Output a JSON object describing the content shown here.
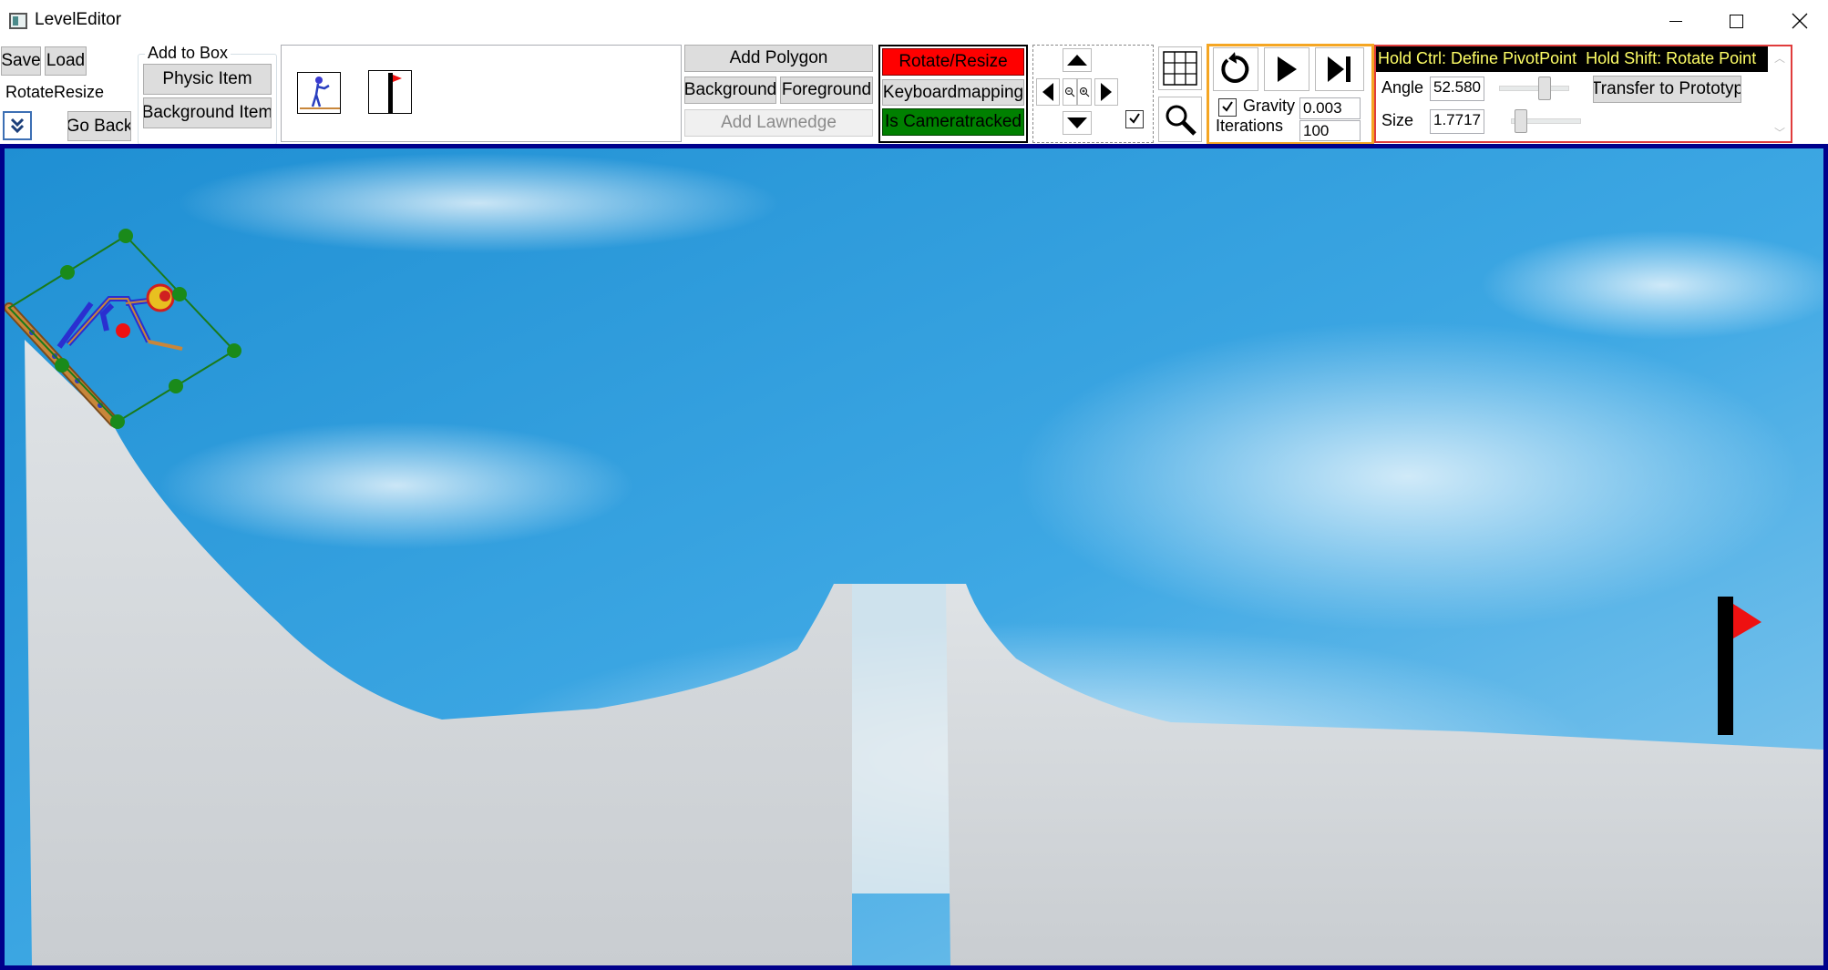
{
  "window": {
    "title": "LevelEditor"
  },
  "toolbar": {
    "save": "Save",
    "load": "Load",
    "mode": "RotateResize",
    "go_back": "Go Back",
    "add_to_box": {
      "title": "Add to Box",
      "physic_item": "Physic Item",
      "background_item": "Background Item"
    },
    "prototypes": [
      "skier-prototype",
      "flag-prototype"
    ],
    "add_polygon": "Add Polygon",
    "background": "Background",
    "foreground": "Foreground",
    "add_lawnedge": "Add Lawnedge",
    "rotate_resize": "Rotate/Resize",
    "keyboardmapping": "Keyboardmapping",
    "is_cameratracked": "Is Cameratracked",
    "simulation": {
      "gravity_label": "Gravity",
      "gravity_checked": true,
      "gravity_value": "0.003",
      "iterations_label": "Iterations",
      "iterations_value": "100"
    },
    "hint": "Hold Ctrl: Define PivotPoint  Hold Shift: Rotate Point",
    "properties": {
      "angle_label": "Angle",
      "angle_value": "52.580",
      "size_label": "Size",
      "size_value": "1.7717",
      "transfer": "Transfer to Prototyp"
    },
    "camera_checkbox_checked": true
  },
  "colors": {
    "rotate_resize_bg": "#ff0000",
    "cameratracked_bg": "#008000",
    "selection": "#1a7a1a",
    "hint_bg": "#000000",
    "hint_fg": "#ffff66",
    "sim_border": "#f5a623",
    "props_border": "#e03c3c",
    "canvas_border": "#00008b"
  },
  "icons": [
    "app-icon",
    "minimize-icon",
    "maximize-icon",
    "close-icon",
    "expand-down-icon",
    "arrow-up-icon",
    "arrow-down-icon",
    "arrow-left-icon",
    "arrow-right-icon",
    "zoom-in-icon",
    "zoom-out-icon",
    "grid-icon",
    "magnifier-icon",
    "reset-icon",
    "play-icon",
    "step-icon",
    "flag-icon"
  ]
}
